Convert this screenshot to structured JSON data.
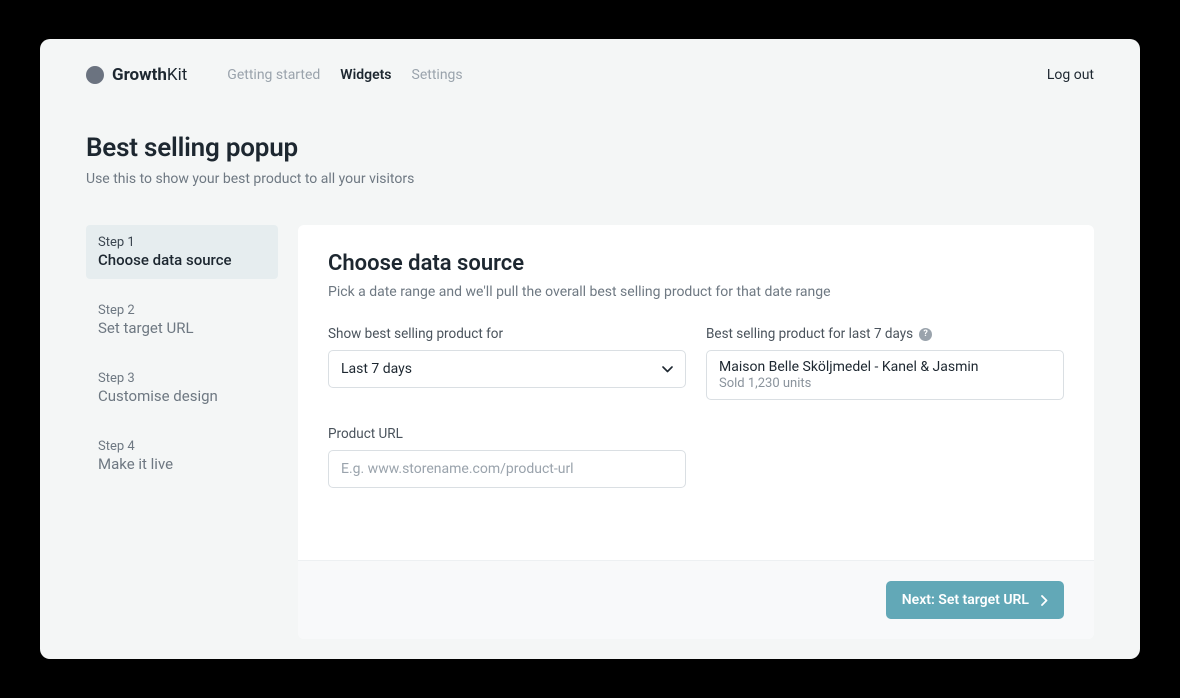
{
  "brand": {
    "bold": "Growth",
    "light": "Kit"
  },
  "nav": {
    "items": [
      {
        "label": "Getting started",
        "active": false
      },
      {
        "label": "Widgets",
        "active": true
      },
      {
        "label": "Settings",
        "active": false
      }
    ],
    "logout": "Log out"
  },
  "page": {
    "title": "Best selling popup",
    "subtitle": "Use this to show your best product to all your visitors"
  },
  "steps": [
    {
      "num": "Step 1",
      "label": "Choose data source",
      "active": true
    },
    {
      "num": "Step 2",
      "label": "Set target URL",
      "active": false
    },
    {
      "num": "Step 3",
      "label": "Customise design",
      "active": false
    },
    {
      "num": "Step 4",
      "label": "Make it live",
      "active": false
    }
  ],
  "panel": {
    "title": "Choose data source",
    "subtitle": "Pick a date range and we'll pull the overall best selling product for that date range",
    "range_label": "Show best selling product for",
    "range_value": "Last 7 days",
    "result_label": "Best selling product for last 7 days",
    "result_product": "Maison Belle Sköljmedel - Kanel & Jasmin",
    "result_units": "Sold 1,230 units",
    "url_label": "Product URL",
    "url_placeholder": "E.g. www.storename.com/product-url",
    "url_value": "",
    "next_label": "Next: Set target URL"
  }
}
